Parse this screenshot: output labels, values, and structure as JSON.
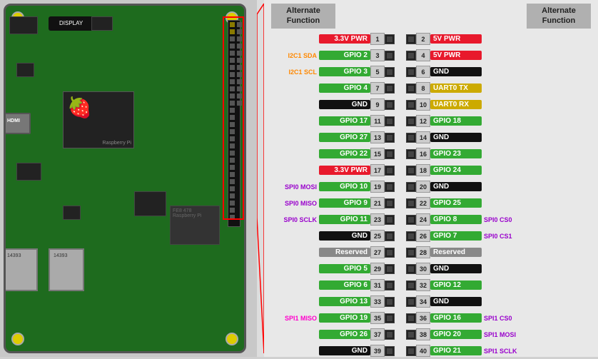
{
  "header": {
    "left_title": "Alternate\nFunction",
    "right_title": "Alternate\nFunction"
  },
  "pins": [
    {
      "left_alt": "",
      "left_name": "3.3V PWR",
      "left_color": "red",
      "left_num": "1",
      "right_num": "2",
      "right_name": "5V PWR",
      "right_color": "red",
      "right_alt": ""
    },
    {
      "left_alt": "I2C1 SDA",
      "left_alt_color": "orange",
      "left_name": "GPIO 2",
      "left_color": "green",
      "left_num": "3",
      "right_num": "4",
      "right_name": "5V PWR",
      "right_color": "red",
      "right_alt": ""
    },
    {
      "left_alt": "I2C1 SCL",
      "left_alt_color": "orange",
      "left_name": "GPIO 3",
      "left_color": "green",
      "left_num": "5",
      "right_num": "6",
      "right_name": "GND",
      "right_color": "black",
      "right_alt": ""
    },
    {
      "left_alt": "",
      "left_name": "GPIO 4",
      "left_color": "green",
      "left_num": "7",
      "right_num": "8",
      "right_name": "UART0 TX",
      "right_color": "yellow",
      "right_alt": ""
    },
    {
      "left_alt": "",
      "left_name": "GND",
      "left_color": "black",
      "left_num": "9",
      "right_num": "10",
      "right_name": "UART0 RX",
      "right_color": "yellow",
      "right_alt": ""
    },
    {
      "left_alt": "",
      "left_name": "GPIO 17",
      "left_color": "green",
      "left_num": "11",
      "right_num": "12",
      "right_name": "GPIO 18",
      "right_color": "green",
      "right_alt": ""
    },
    {
      "left_alt": "",
      "left_name": "GPIO 27",
      "left_color": "green",
      "left_num": "13",
      "right_num": "14",
      "right_name": "GND",
      "right_color": "black",
      "right_alt": ""
    },
    {
      "left_alt": "",
      "left_name": "GPIO 22",
      "left_color": "green",
      "left_num": "15",
      "right_num": "16",
      "right_name": "GPIO 23",
      "right_color": "green",
      "right_alt": ""
    },
    {
      "left_alt": "",
      "left_name": "3.3V PWR",
      "left_color": "red",
      "left_num": "17",
      "right_num": "18",
      "right_name": "GPIO 24",
      "right_color": "green",
      "right_alt": ""
    },
    {
      "left_alt": "SPI0 MOSI",
      "left_alt_color": "purple",
      "left_name": "GPIO 10",
      "left_color": "green",
      "left_num": "19",
      "right_num": "20",
      "right_name": "GND",
      "right_color": "black",
      "right_alt": ""
    },
    {
      "left_alt": "SPI0 MISO",
      "left_alt_color": "purple",
      "left_name": "GPIO 9",
      "left_color": "green",
      "left_num": "21",
      "right_num": "22",
      "right_name": "GPIO 25",
      "right_color": "green",
      "right_alt": ""
    },
    {
      "left_alt": "SPI0 SCLK",
      "left_alt_color": "purple",
      "left_name": "GPIO 11",
      "left_color": "green",
      "left_num": "23",
      "right_num": "24",
      "right_name": "GPIO 8",
      "right_color": "green",
      "right_alt": "SPI0 CS0"
    },
    {
      "left_alt": "",
      "left_name": "GND",
      "left_color": "black",
      "left_num": "25",
      "right_num": "26",
      "right_name": "GPIO 7",
      "right_color": "green",
      "right_alt": "SPI0 CS1"
    },
    {
      "left_alt": "",
      "left_name": "Reserved",
      "left_color": "gray",
      "left_num": "27",
      "right_num": "28",
      "right_name": "Reserved",
      "right_color": "gray",
      "right_alt": ""
    },
    {
      "left_alt": "",
      "left_name": "GPIO 5",
      "left_color": "green",
      "left_num": "29",
      "right_num": "30",
      "right_name": "GND",
      "right_color": "black",
      "right_alt": ""
    },
    {
      "left_alt": "",
      "left_name": "GPIO 6",
      "left_color": "green",
      "left_num": "31",
      "right_num": "32",
      "right_name": "GPIO 12",
      "right_color": "green",
      "right_alt": ""
    },
    {
      "left_alt": "",
      "left_name": "GPIO 13",
      "left_color": "green",
      "left_num": "33",
      "right_num": "34",
      "right_name": "GND",
      "right_color": "black",
      "right_alt": ""
    },
    {
      "left_alt": "SPI1 MISO",
      "left_alt_color": "pink",
      "left_name": "GPIO 19",
      "left_color": "green",
      "left_num": "35",
      "right_num": "36",
      "right_name": "GPIO 16",
      "right_color": "green",
      "right_alt": "SPI1 CS0"
    },
    {
      "left_alt": "",
      "left_name": "GPIO 26",
      "left_color": "green",
      "left_num": "37",
      "right_num": "38",
      "right_name": "GPIO 20",
      "right_color": "green",
      "right_alt": "SPI1 MOSI"
    },
    {
      "left_alt": "",
      "left_name": "GND",
      "left_color": "black",
      "left_num": "39",
      "right_num": "40",
      "right_name": "GPIO 21",
      "right_color": "green",
      "right_alt": "SPI1 SCLK"
    }
  ]
}
